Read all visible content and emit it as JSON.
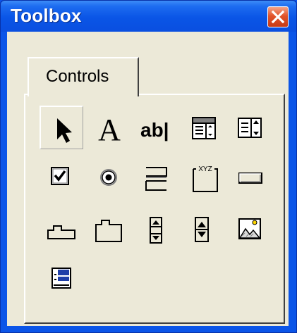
{
  "window": {
    "title": "Toolbox",
    "close_glyph": "✕"
  },
  "tabs": [
    {
      "label": "Controls",
      "selected": true
    }
  ],
  "controls": [
    {
      "name": "pointer",
      "icon": "pointer-icon",
      "selected": true
    },
    {
      "name": "label",
      "icon": "label-icon"
    },
    {
      "name": "textbox",
      "icon": "textbox-icon"
    },
    {
      "name": "combobox",
      "icon": "combobox-icon"
    },
    {
      "name": "listbox",
      "icon": "listbox-icon"
    },
    {
      "name": "checkbox",
      "icon": "checkbox-icon"
    },
    {
      "name": "optionbutton",
      "icon": "option-button-icon"
    },
    {
      "name": "togglebutton",
      "icon": "toggle-button-icon"
    },
    {
      "name": "frame",
      "icon": "frame-icon"
    },
    {
      "name": "commandbutton",
      "icon": "command-button-icon"
    },
    {
      "name": "tabstrip",
      "icon": "tabstrip-icon"
    },
    {
      "name": "multipage",
      "icon": "multipage-icon"
    },
    {
      "name": "scrollbar",
      "icon": "scrollbar-icon"
    },
    {
      "name": "spinbutton",
      "icon": "spinbutton-icon"
    },
    {
      "name": "image",
      "icon": "image-icon"
    },
    {
      "name": "refedit",
      "icon": "refedit-icon"
    }
  ],
  "icon_text": {
    "label_glyph": "A",
    "textbox_text": "ab|",
    "frame_caption": "XYZ"
  },
  "colors": {
    "titlebar": "#0a55e6",
    "client": "#ece9d8",
    "close_button": "#e2542a"
  }
}
